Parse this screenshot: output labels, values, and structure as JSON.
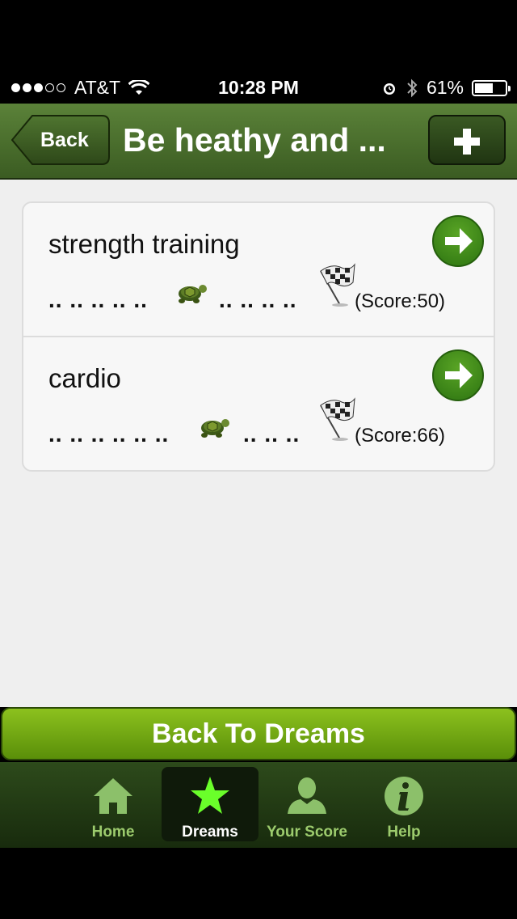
{
  "status_bar": {
    "carrier": "AT&T",
    "time": "10:28 PM",
    "battery_percent": "61%",
    "battery_level": 0.61
  },
  "nav": {
    "back_label": "Back",
    "title": "Be heathy and ...",
    "add_label": "+"
  },
  "goals": [
    {
      "title": "strength training",
      "dots_before": ".. .. .. .. ..",
      "dots_after": ".. .. .. ..",
      "score": "(Score:50)"
    },
    {
      "title": "cardio",
      "dots_before": ".. .. .. .. .. ..",
      "dots_after": ".. .. ..",
      "score": "(Score:66)"
    }
  ],
  "back_to_dreams_label": "Back To Dreams",
  "tabs": [
    {
      "label": "Home",
      "icon": "home-icon"
    },
    {
      "label": "Dreams",
      "icon": "star-icon"
    },
    {
      "label": "Your Score",
      "icon": "person-icon"
    },
    {
      "label": "Help",
      "icon": "info-icon"
    }
  ],
  "colors": {
    "nav_green": "#4a6d2c",
    "button_green": "#7aad13",
    "active_star": "#6aff2a",
    "tab_label": "#9ccb6d"
  }
}
